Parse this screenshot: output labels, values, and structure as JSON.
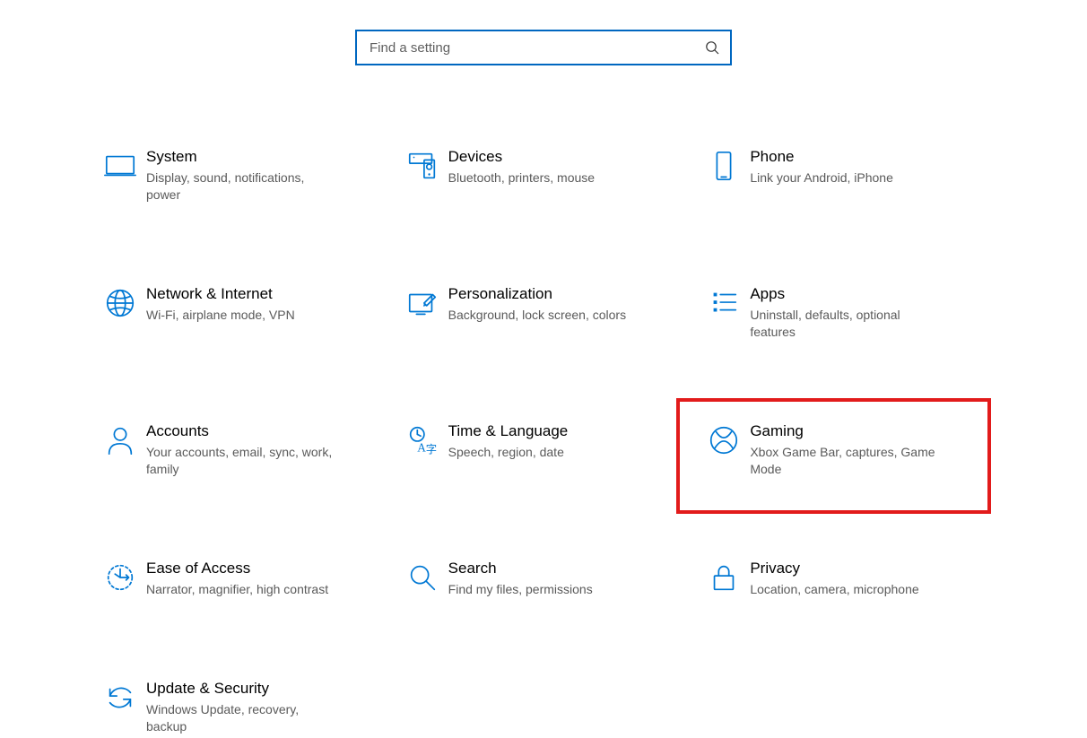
{
  "search": {
    "placeholder": "Find a setting"
  },
  "tiles": {
    "system": {
      "title": "System",
      "desc": "Display, sound, notifications, power"
    },
    "devices": {
      "title": "Devices",
      "desc": "Bluetooth, printers, mouse"
    },
    "phone": {
      "title": "Phone",
      "desc": "Link your Android, iPhone"
    },
    "network": {
      "title": "Network & Internet",
      "desc": "Wi-Fi, airplane mode, VPN"
    },
    "personalization": {
      "title": "Personalization",
      "desc": "Background, lock screen, colors"
    },
    "apps": {
      "title": "Apps",
      "desc": "Uninstall, defaults, optional features"
    },
    "accounts": {
      "title": "Accounts",
      "desc": "Your accounts, email, sync, work, family"
    },
    "time": {
      "title": "Time & Language",
      "desc": "Speech, region, date"
    },
    "gaming": {
      "title": "Gaming",
      "desc": "Xbox Game Bar, captures, Game Mode"
    },
    "ease": {
      "title": "Ease of Access",
      "desc": "Narrator, magnifier, high contrast"
    },
    "search": {
      "title": "Search",
      "desc": "Find my files, permissions"
    },
    "privacy": {
      "title": "Privacy",
      "desc": "Location, camera, microphone"
    },
    "update": {
      "title": "Update & Security",
      "desc": "Windows Update, recovery, backup"
    }
  }
}
